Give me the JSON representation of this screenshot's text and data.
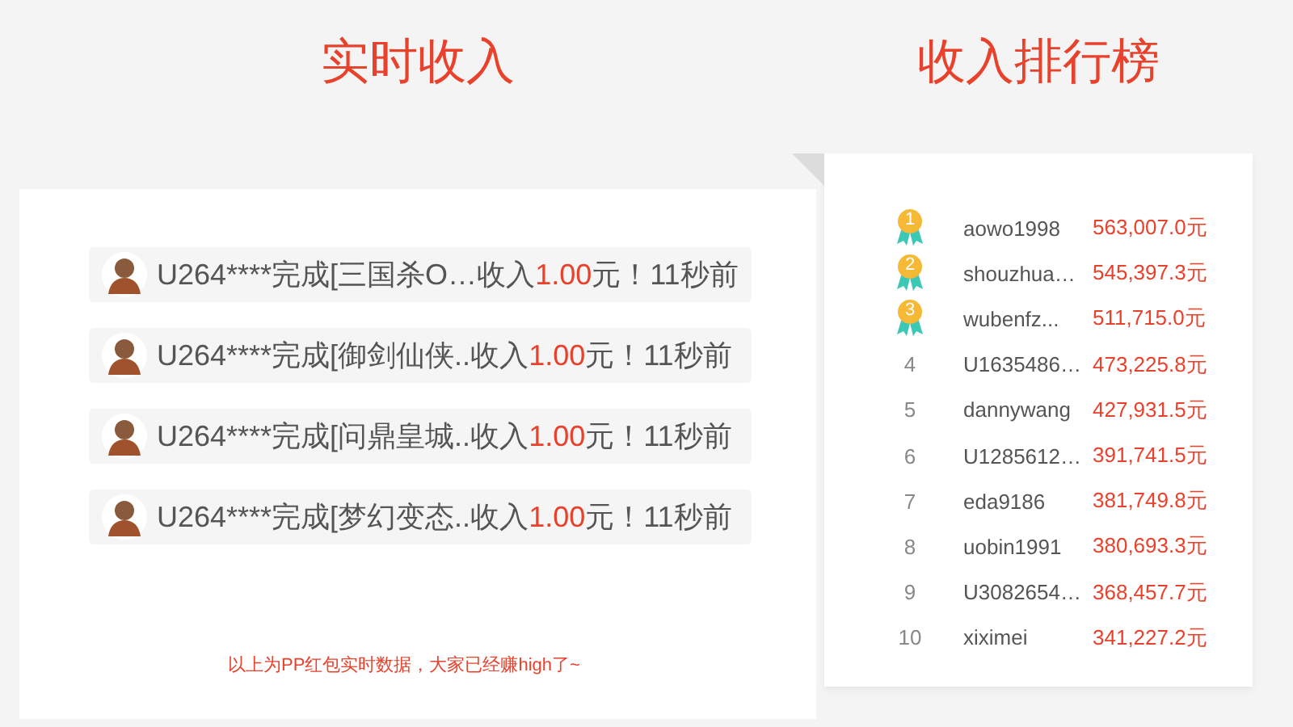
{
  "realtime": {
    "title": "实时收入",
    "items": [
      {
        "text_before": "U264****完成[三国杀O…收入",
        "amount": "1.00",
        "text_after": "元！",
        "time": "11秒前"
      },
      {
        "text_before": "U264****完成[御剑仙侠..收入",
        "amount": "1.00",
        "text_after": "元！",
        "time": "11秒前"
      },
      {
        "text_before": "U264****完成[问鼎皇城..收入",
        "amount": "1.00",
        "text_after": "元！",
        "time": "11秒前"
      },
      {
        "text_before": "U264****完成[梦幻变态..收入",
        "amount": "1.00",
        "text_after": "元！",
        "time": "11秒前"
      }
    ],
    "footnote": "以上为PP红包实时数据，大家已经赚high了~"
  },
  "ranking": {
    "title": "收入排行榜",
    "rows": [
      {
        "kind": "medal",
        "rank": "1",
        "name": "aowo1998",
        "income": "563,007.0元"
      },
      {
        "kind": "medal",
        "rank": "2",
        "name": "shouzhua…",
        "income": "545,397.3元"
      },
      {
        "kind": "medal",
        "rank": "3",
        "name": "wubenfz...",
        "income": "511,715.0元"
      },
      {
        "kind": "number",
        "rank": "4",
        "name": "U1635486…",
        "income": "473,225.8元"
      },
      {
        "kind": "number",
        "rank": "5",
        "name": "dannywang",
        "income": "427,931.5元"
      },
      {
        "kind": "number",
        "rank": "6",
        "name": "U1285612…",
        "income": "391,741.5元"
      },
      {
        "kind": "number",
        "rank": "7",
        "name": "eda9186",
        "income": "381,749.8元"
      },
      {
        "kind": "number",
        "rank": "8",
        "name": "uobin1991",
        "income": "380,693.3元"
      },
      {
        "kind": "number",
        "rank": "9",
        "name": "U3082654…",
        "income": "368,457.7元"
      },
      {
        "kind": "number",
        "rank": "10",
        "name": "xiximei",
        "income": "341,227.2元"
      }
    ]
  }
}
